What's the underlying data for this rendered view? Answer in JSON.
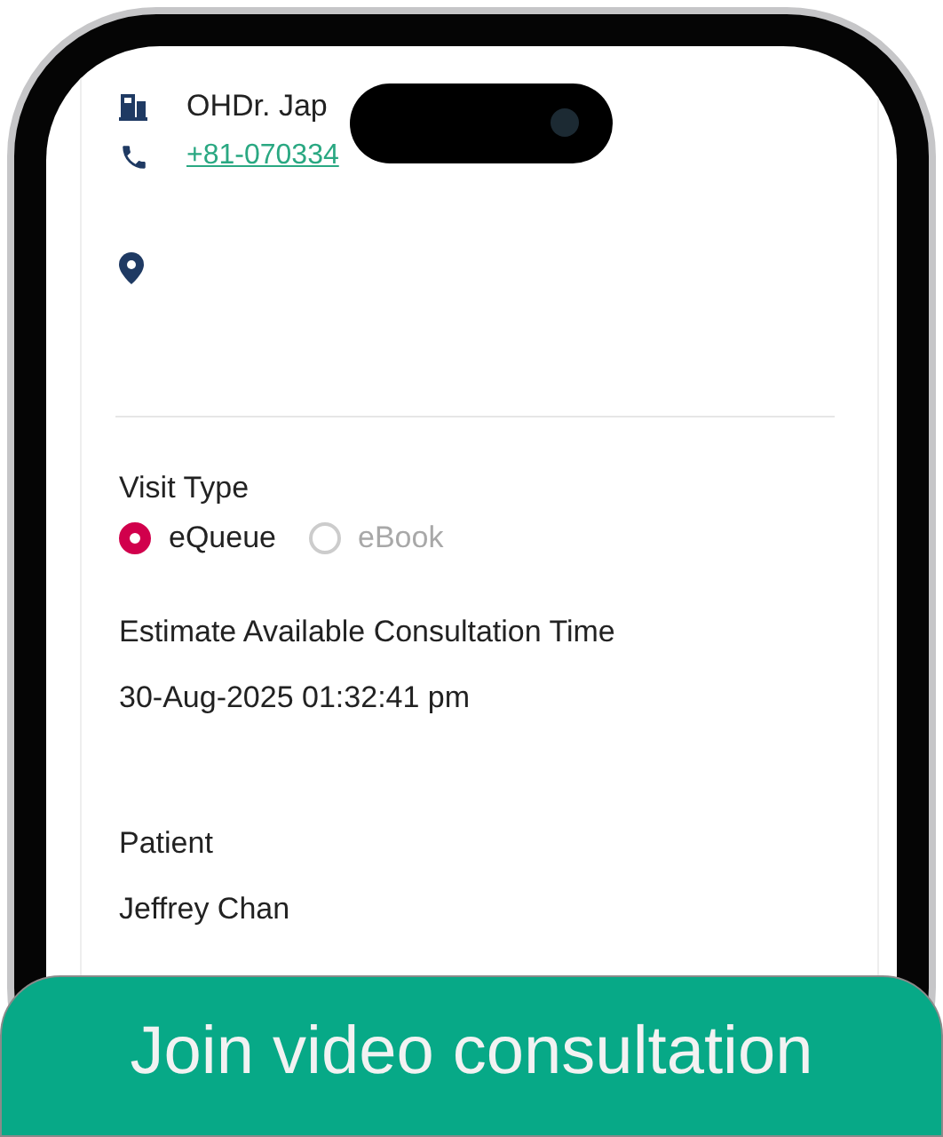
{
  "contact": {
    "clinic": "OHDr. Jap",
    "phone": "+81-070334"
  },
  "visit_type": {
    "label": "Visit Type",
    "options": [
      {
        "label": "eQueue",
        "selected": true
      },
      {
        "label": "eBook",
        "selected": false
      }
    ]
  },
  "fields": [
    {
      "label": "Estimate Available Consultation Time",
      "value": "30-Aug-2025 01:32:41 pm"
    },
    {
      "label": "Patient",
      "value": "Jeffrey Chan"
    }
  ],
  "action_button": "Join video consultation"
}
